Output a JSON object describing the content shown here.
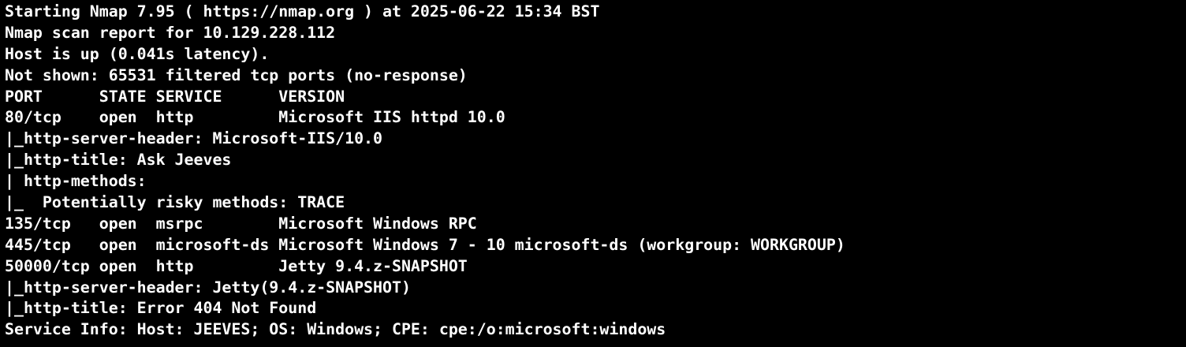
{
  "terminal": {
    "lines": [
      "Starting Nmap 7.95 ( https://nmap.org ) at 2025-06-22 15:34 BST",
      "Nmap scan report for 10.129.228.112",
      "Host is up (0.041s latency).",
      "Not shown: 65531 filtered tcp ports (no-response)",
      "PORT      STATE SERVICE      VERSION",
      "80/tcp    open  http         Microsoft IIS httpd 10.0",
      "|_http-server-header: Microsoft-IIS/10.0",
      "|_http-title: Ask Jeeves",
      "| http-methods:",
      "|_  Potentially risky methods: TRACE",
      "135/tcp   open  msrpc        Microsoft Windows RPC",
      "445/tcp   open  microsoft-ds Microsoft Windows 7 - 10 microsoft-ds (workgroup: WORKGROUP)",
      "50000/tcp open  http         Jetty 9.4.z-SNAPSHOT",
      "|_http-server-header: Jetty(9.4.z-SNAPSHOT)",
      "|_http-title: Error 404 Not Found",
      "Service Info: Host: JEEVES; OS: Windows; CPE: cpe:/o:microsoft:windows"
    ]
  },
  "colors": {
    "background": "#000000",
    "foreground": "#ffffff"
  }
}
